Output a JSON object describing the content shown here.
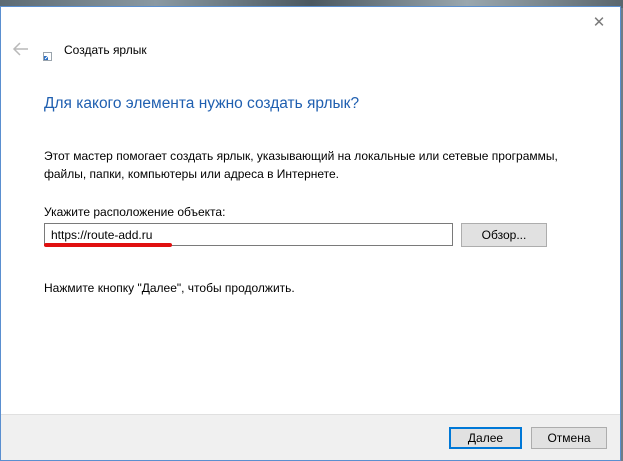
{
  "window": {
    "title": "Создать ярлык",
    "close_icon": "close-icon",
    "back_icon": "back-arrow-icon"
  },
  "content": {
    "heading": "Для какого элемента нужно создать ярлык?",
    "description": "Этот мастер помогает создать ярлык, указывающий на локальные или сетевые программы, файлы, папки, компьютеры или адреса в Интернете.",
    "location_label": "Укажите расположение объекта:",
    "location_value": "https://route-add.ru",
    "browse_label": "Обзор...",
    "hint": "Нажмите кнопку \"Далее\", чтобы продолжить."
  },
  "footer": {
    "next_label": "Далее",
    "cancel_label": "Отмена"
  },
  "colors": {
    "heading": "#1f5fb0",
    "accent_border": "#0078d7",
    "highlight_underline": "#e01010"
  }
}
